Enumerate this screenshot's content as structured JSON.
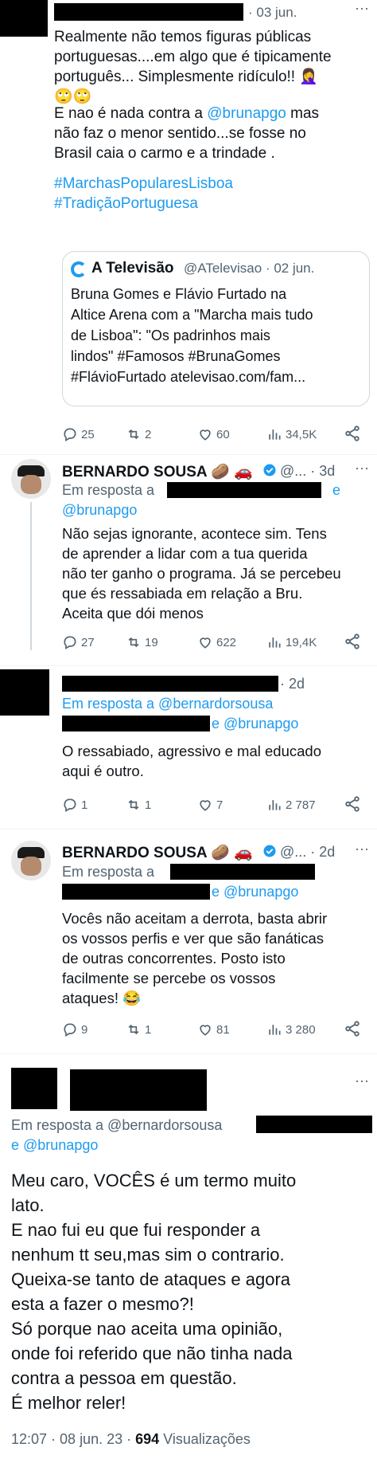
{
  "tweet1": {
    "date": "· 03 jun.",
    "text": "Realmente não temos figuras públicas\nportuguesas....em algo que é tipicamente\nportuguês... Simplesmente ridículo!! 🤦‍♀️\n🙄🙄",
    "text2_a": "E nao é nada contra a ",
    "mention": "@brunapgo",
    "text2_b": " mas\nnão faz o menor sentido...se fosse no\nBrasil caia o carmo e a trindade .",
    "hashtag1": "#MarchasPopularesLisboa",
    "hashtag2": "#TradiçãoPortuguesa",
    "quote": {
      "account_name": "A Televisão",
      "handle_date": "@ATelevisao · 02 jun.",
      "text": "Bruna Gomes e Flávio Furtado na\nAltice Arena com a \"Marcha mais tudo\nde Lisboa\": \"Os padrinhos mais\nlindos\" #Famosos #BrunaGomes\n#FlávioFurtado atelevisao.com/fam..."
    },
    "replies": "25",
    "retweets": "2",
    "likes": "60",
    "views": "34,5K"
  },
  "tweet2": {
    "name": "BERNARDO SOUSA 🥔 🚗",
    "handle_date": "@... · 3d",
    "reply_to_label": "Em resposta a",
    "reply_to_e": "e",
    "reply_to_mention": "@brunapgo",
    "text": "Não sejas ignorante, acontece sim. Tens\nde aprender a lidar com a tua querida\nnão ter ganho o programa. Já se percebeu\nque és ressabiada em relação a Bru.\nAceita que dói menos",
    "replies": "27",
    "retweets": "19",
    "likes": "622",
    "views": "19,4K"
  },
  "tweet3": {
    "date": "· 2d",
    "reply_to_label": "Em resposta a @bernardorsousa",
    "reply_to_line2": "e @brunapgo",
    "text": "O ressabiado, agressivo e mal educado\naqui é outro.",
    "replies": "1",
    "retweets": "1",
    "likes": "7",
    "views": "2 787"
  },
  "tweet4": {
    "name": "BERNARDO SOUSA 🥔 🚗",
    "handle_date": "@... · 2d",
    "reply_to_label": "Em resposta a",
    "reply_to_line2": "e @brunapgo",
    "text": "Vocês não aceitam a derrota, basta abrir\nos vossos perfis e ver que são fanáticas\nde outras concorrentes. Posto isto\nfacilmente se percebe os vossos\nataques! 😂",
    "replies": "9",
    "retweets": "1",
    "likes": "81",
    "views": "3 280"
  },
  "tweet5": {
    "reply_to_label": "Em resposta a @bernardorsousa",
    "reply_to_line2": "e @brunapgo",
    "text": "Meu caro, VOCÊS é um termo muito\nlato.\nE nao fui eu que fui responder a\nnenhum tt seu,mas sim o contrario.\nQueixa-se tanto de ataques e agora\nesta a fazer o mesmo?!\nSó porque nao aceita uma opinião,\nonde foi referido que não tinha nada\ncontra a pessoa em questão.\nÉ melhor reler!",
    "timestamp": "12:07 · 08 jun. 23 · ",
    "views_count": "694",
    "views_label": " Visualizações"
  },
  "colors": {
    "link": "#1d9bf0",
    "muted": "#536471",
    "text": "#0f1419"
  }
}
